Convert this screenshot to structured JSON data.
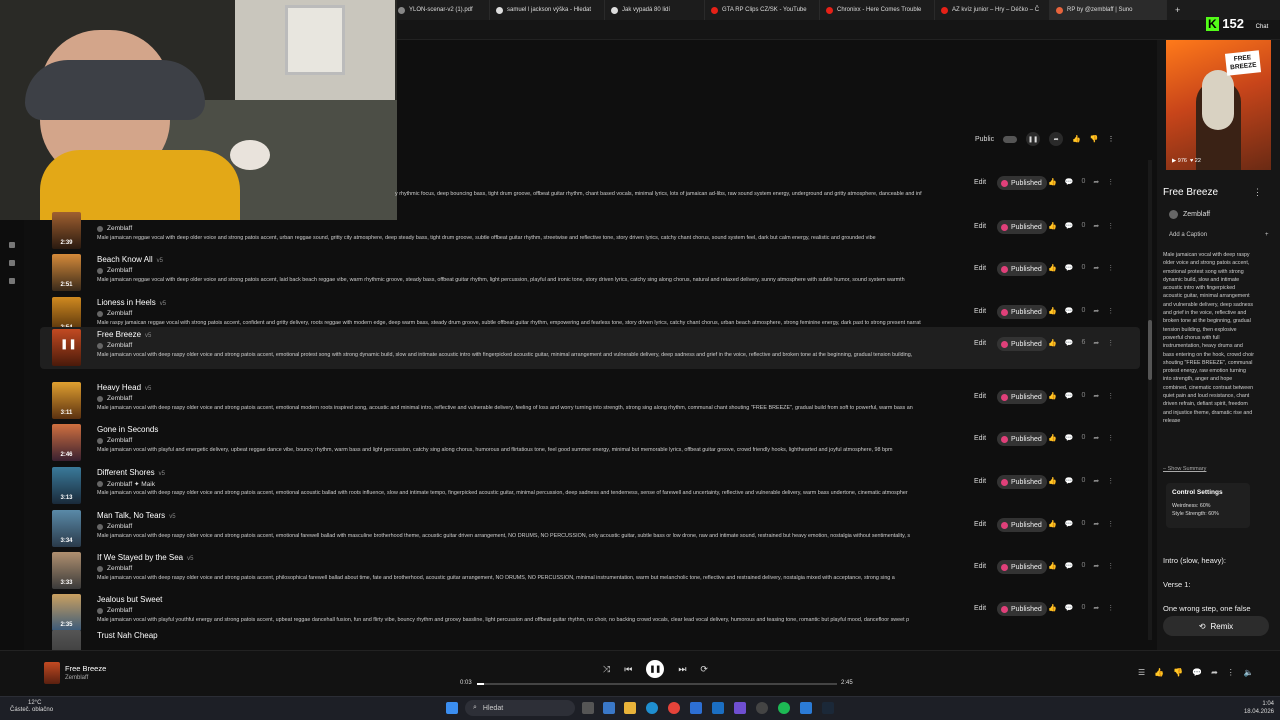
{
  "browser": {
    "tabs": [
      {
        "label": "YLON-scenar-v2 (1).pdf",
        "color": "#888888"
      },
      {
        "label": "samuel l jackson výška - Hledat",
        "color": "#dddddd"
      },
      {
        "label": "Jak vypadá 80 lidí",
        "color": "#dddddd"
      },
      {
        "label": "GTA RP Clips CZ/SK - YouTube",
        "color": "#e62117"
      },
      {
        "label": "Chronixx - Here Comes Trouble",
        "color": "#e62117"
      },
      {
        "label": "AZ kvíz junior – Hry – Déčko – Č",
        "color": "#e62117"
      },
      {
        "label": "RP by @zemblaff | Suno",
        "color": "#e8643c"
      }
    ],
    "new_tab": "+",
    "window_controls": [
      "–",
      "□",
      "×"
    ]
  },
  "overlay": {
    "viewers": "152",
    "chat_label": "Chat"
  },
  "song_header": {
    "visibility": "Public",
    "icons": [
      "pause-icon",
      "share-icon",
      "like-icon",
      "dislike-icon",
      "more-icon"
    ]
  },
  "songs": [
    {
      "title": "",
      "version": "",
      "duration": "",
      "author": "",
      "description": "y rhythmic focus, deep bouncing bass, tight drum groove, offbeat guitar rhythm, chant based vocals, minimal lyrics, lots of jamaican ad-libs, raw sound system energy, underground and gritty atmosphere, danceable and inf",
      "likes": "0"
    },
    {
      "title": "",
      "version": "",
      "duration": "2:39",
      "author": "Zemblaff",
      "description": "Male jamaican reggae vocal with deep older voice and strong patois accent, urban reggae sound, gritty city atmosphere, deep steady bass, tight drum groove, subtle offbeat guitar rhythm, streetwise and reflective tone, story driven lyrics, catchy chant chorus, sound system feel, dark but calm energy, realistic and grounded vibe",
      "likes": "0"
    },
    {
      "title": "Beach Know All",
      "version": "v5",
      "duration": "2:51",
      "author": "Zemblaff",
      "description": "Male jamaican reggae vocal with deep older voice and strong patois accent, laid back beach reggae vibe, warm rhythmic groove, steady bass, offbeat guitar rhythm, light percussion, playful and ironic tone, story driven lyrics, catchy sing along chorus, natural and relaxed delivery, sunny atmosphere with subtle humor, sound system warmth",
      "likes": "0"
    },
    {
      "title": "Lioness in Heels",
      "version": "v5",
      "duration": "2:54",
      "author": "Zemblaff",
      "description": "Male raspy jamaican reggae vocal with strong patois accent, confident and gritty delivery, roots reggae with modern edge, deep warm bass, steady drum groove, subtle offbeat guitar rhythm, empowering and fearless tone, story driven lyrics, catchy chant chorus, urban beach atmosphere, strong feminine energy, dark past to strong present narrat",
      "likes": "0"
    },
    {
      "title": "Free Breeze",
      "version": "v5",
      "duration": "",
      "author": "Zemblaff",
      "description": "Male jamaican vocal with deep raspy older voice and strong patois accent, emotional protest song with strong dynamic build, slow and intimate acoustic intro with fingerpicked acoustic guitar, minimal arrangement and vulnerable delivery, deep sadness and grief in the voice, reflective and broken tone at the beginning, gradual tension building,",
      "likes": "6"
    },
    {
      "title": "Heavy Head",
      "version": "v5",
      "duration": "3:11",
      "author": "Zemblaff",
      "description": "Male jamaican vocal with deep raspy older voice and strong patois accent, emotional modern roots inspired song, acoustic and minimal intro, reflective and vulnerable delivery, feeling of loss and worry turning into strength, strong sing along rhythm, communal chant shouting \"FREE BREEZE\", gradual build from soft to powerful, warm bass an",
      "likes": "0"
    },
    {
      "title": "Gone in Seconds",
      "version": "",
      "duration": "2:46",
      "author": "Zemblaff",
      "description": "Male jamaican vocal with playful and energetic delivery, upbeat reggae dance vibe, bouncy rhythm, warm bass and light percussion, catchy sing along chorus, humorous and flirtatious tone, feel good summer energy, minimal but memorable lyrics, offbeat guitar groove, crowd friendly hooks, lighthearted and joyful atmosphere, 98 bpm",
      "likes": "0"
    },
    {
      "title": "Different Shores",
      "version": "v5",
      "duration": "3:13",
      "author": "Zemblaff  ✦ Maik",
      "description": "Male jamaican vocal with deep raspy older voice and strong patois accent, emotional acoustic ballad with roots influence, slow and intimate tempo, fingerpicked acoustic guitar, minimal percussion, deep sadness and tenderness, sense of farewell and uncertainty, reflective and vulnerable delivery, warm bass undertone, cinematic atmospher",
      "likes": "0"
    },
    {
      "title": "Man Talk, No Tears",
      "version": "v5",
      "duration": "3:34",
      "author": "Zemblaff",
      "description": "Male jamaican vocal with deep raspy older voice and strong patois accent, emotional farewell ballad with masculine brotherhood theme, acoustic guitar driven arrangement, NO DRUMS, NO PERCUSSION, only acoustic guitar, subtle bass or low drone, raw and intimate sound, restrained but heavy emotion, nostalgia without sentimentality, s",
      "likes": "0"
    },
    {
      "title": "If We Stayed by the Sea",
      "version": "v5",
      "duration": "3:33",
      "author": "Zemblaff",
      "description": "Male jamaican vocal with deep raspy older voice and strong patois accent, philosophical farewell ballad about time, fate and brotherhood, acoustic guitar arrangement, NO DRUMS, NO PERCUSSION, minimal instrumentation, warm but melancholic tone, reflective and restrained delivery, nostalgia mixed with acceptance, strong sing a",
      "likes": "0"
    },
    {
      "title": "Jealous but Sweet",
      "version": "",
      "duration": "2:35",
      "author": "Zemblaff",
      "description": "Male jamaican vocal with playful youthful energy and strong patois accent, upbeat reggae dancehall fusion, fun and flirty vibe, bouncy rhythm and groovy bassline, light percussion and offbeat guitar rhythm, no choir, no backing crowd vocals, clear lead vocal delivery, humorous and teasing tone, romantic but playful mood, dancefloor sweet p",
      "likes": "0"
    },
    {
      "title": "Trust Nah Cheap",
      "version": "",
      "duration": "",
      "author": "",
      "description": "",
      "likes": ""
    }
  ],
  "row_labels": {
    "edit": "Edit",
    "published": "Published"
  },
  "right_panel": {
    "cover_title": "FREE BREEZE",
    "cover_plays": "▶ 976",
    "cover_likes": "♥ 22",
    "title": "Free Breeze",
    "author": "Zemblaff",
    "add_caption": "Add a Caption",
    "add_caption_plus": "+",
    "description": "Male jamaican vocal with deep raspy older voice and strong patois accent, emotional protest song with strong dynamic build, slow and intimate acoustic intro with fingerpicked acoustic guitar, minimal arrangement and vulnerable delivery, deep sadness and grief in the voice, reflective and broken tone at the beginning, gradual tension building, then explosive powerful chorus with full instrumentation, heavy drums and bass entering on the hook, crowd choir shouting \"FREE BREEZE\", communal protest energy, raw emotion turning into strength, anger and hope combined, cinematic contrast between quiet pain and loud resistance, chant driven refrain, defiant spirit, freedom and injustice theme, dramatic rise and release",
    "show_summary": "– Show Summary",
    "control_heading": "Control Settings",
    "weirdness": "Weirdness: 60%",
    "style_strength": "Style Strength: 60%",
    "lyrics": [
      "Intro (slow, heavy):",
      "Verse 1:",
      "One wrong step, one false"
    ],
    "remix": "Remix"
  },
  "player": {
    "title": "Free Breeze",
    "author": "Zemblaff",
    "current_time": "0:03",
    "total_time": "2:45",
    "progress": 0.02
  },
  "taskbar": {
    "temperature": "12°C",
    "weather": "Částeč. oblačno",
    "search_placeholder": "Hledat",
    "time": "1:04",
    "date": "18.04.2026"
  }
}
